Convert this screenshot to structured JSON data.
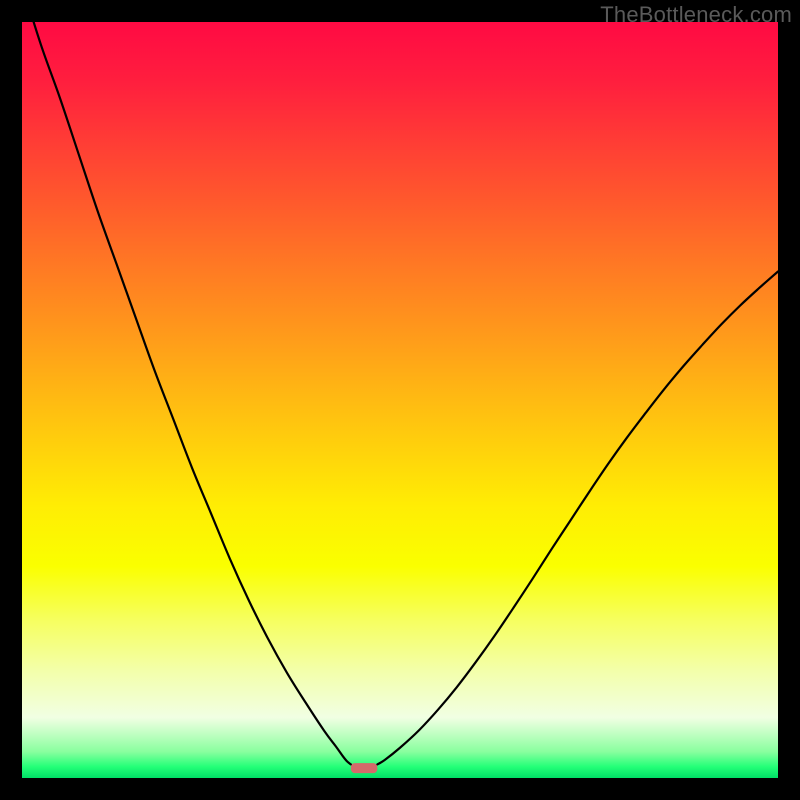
{
  "watermark": "TheBottleneck.com",
  "chart_data": {
    "type": "line",
    "title": "",
    "xlabel": "",
    "ylabel": "",
    "xlim": [
      0,
      100
    ],
    "ylim": [
      0,
      100
    ],
    "grid": false,
    "legend": false,
    "series": [
      {
        "name": "left-branch",
        "x": [
          0,
          2.5,
          5,
          7.5,
          10,
          12.5,
          15,
          17.5,
          20,
          22.5,
          25,
          27.5,
          30,
          32.5,
          35,
          37.5,
          40,
          41.5,
          42.5,
          43,
          43.5
        ],
        "values": [
          105,
          97,
          90,
          82.5,
          75,
          68,
          61,
          54,
          47.5,
          41,
          35,
          29,
          23.5,
          18.5,
          14,
          10,
          6.2,
          4.2,
          2.8,
          2.2,
          1.8
        ]
      },
      {
        "name": "right-branch",
        "x": [
          47,
          48,
          50,
          52.5,
          55,
          57.5,
          60,
          62.5,
          65,
          67.5,
          70,
          72.5,
          75,
          77.5,
          80,
          82.5,
          85,
          87.5,
          90,
          92.5,
          95,
          97.5,
          100
        ],
        "values": [
          1.8,
          2.4,
          4,
          6.3,
          9,
          12,
          15.3,
          18.8,
          22.5,
          26.3,
          30.2,
          34,
          37.8,
          41.5,
          45,
          48.3,
          51.5,
          54.5,
          57.3,
          60,
          62.5,
          64.8,
          67
        ]
      }
    ],
    "valley_marker": {
      "x_start": 43.5,
      "x_end": 47,
      "y": 1.3
    },
    "gradient_stops": [
      {
        "offset": 0.0,
        "color": "#ff0a43"
      },
      {
        "offset": 0.08,
        "color": "#ff1f3e"
      },
      {
        "offset": 0.16,
        "color": "#ff3d35"
      },
      {
        "offset": 0.24,
        "color": "#ff5a2c"
      },
      {
        "offset": 0.32,
        "color": "#ff7824"
      },
      {
        "offset": 0.4,
        "color": "#ff951c"
      },
      {
        "offset": 0.48,
        "color": "#ffb314"
      },
      {
        "offset": 0.56,
        "color": "#ffd00c"
      },
      {
        "offset": 0.64,
        "color": "#ffed04"
      },
      {
        "offset": 0.72,
        "color": "#faff00"
      },
      {
        "offset": 0.79,
        "color": "#f6ff5e"
      },
      {
        "offset": 0.86,
        "color": "#f3ffac"
      },
      {
        "offset": 0.92,
        "color": "#f1ffe3"
      },
      {
        "offset": 0.965,
        "color": "#8aff9f"
      },
      {
        "offset": 0.985,
        "color": "#24ff78"
      },
      {
        "offset": 1.0,
        "color": "#00df66"
      }
    ],
    "marker_color": "#d46a6a"
  }
}
